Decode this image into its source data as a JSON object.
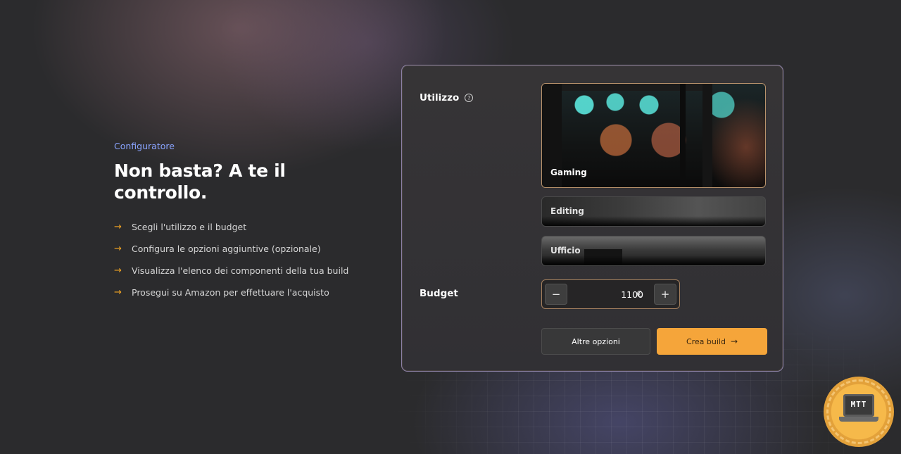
{
  "intro": {
    "eyebrow": "Configuratore",
    "heading_line1": "Non basta? A te il",
    "heading_line2": "controllo.",
    "steps": [
      {
        "icon": "arrow-right-icon",
        "text": "Scegli l'utilizzo e il budget"
      },
      {
        "icon": "arrow-right-icon",
        "text": "Configura le opzioni aggiuntive (opzionale)"
      },
      {
        "icon": "arrow-right-icon",
        "text": "Visualizza l'elenco dei componenti della tua build"
      },
      {
        "icon": "arrow-right-icon",
        "text": "Prosegui su Amazon per effettuare l'acquisto"
      }
    ]
  },
  "configurator": {
    "usage_label": "Utilizzo",
    "usage_help_icon": "question-circle-icon",
    "options": [
      {
        "label": "Gaming",
        "selected": true
      },
      {
        "label": "Editing",
        "selected": false
      },
      {
        "label": "Ufficio",
        "selected": false
      }
    ],
    "budget_label": "Budget",
    "budget": {
      "value": "1100",
      "currency": "€",
      "decrement_label": "−",
      "increment_label": "+"
    },
    "more_options_label": "Altre opzioni",
    "create_build_label": "Crea build",
    "create_build_icon": "arrow-right-icon"
  },
  "logo": {
    "text": "MTT"
  },
  "colors": {
    "accent": "#f5a53a",
    "eyebrow": "#8aa4ff",
    "selected_border": "#b9936c",
    "card_border": "#8d82a6"
  }
}
